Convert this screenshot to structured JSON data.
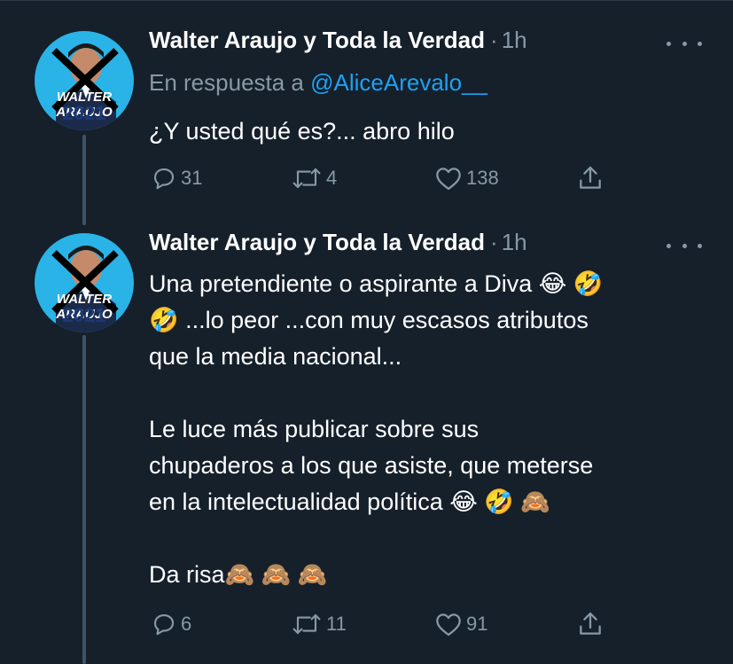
{
  "tweets": [
    {
      "author": "Walter Araujo y Toda la Verdad",
      "dot": "·",
      "time": "1h",
      "reply_prefix": "En respuesta a ",
      "reply_handle": "@AliceArevalo__",
      "text": "¿Y usted qué es?... abro hilo",
      "replies": "31",
      "retweets": "4",
      "likes": "138"
    },
    {
      "author": "Walter Araujo y Toda la Verdad",
      "dot": "·",
      "time": "1h",
      "text": "Una pretendiente o aspirante a Diva 😂 🤣\n🤣 ...lo peor ...con muy escasos atributos\nque la media nacional...\n\nLe luce más publicar sobre sus\nchupaderos a los que asiste, que meterse\nen la intelectualidad política 😂 🤣 🙈\n\nDa risa🙈 🙈 🙈",
      "replies": "6",
      "retweets": "11",
      "likes": "91"
    }
  ],
  "avatar": {
    "line1": "WALTER ARAUJO",
    "line2": "2021"
  },
  "icons": [
    "reply-icon",
    "retweet-icon",
    "like-icon",
    "share-icon",
    "more-icon"
  ],
  "colors": {
    "background": "#15202b",
    "secondary": "#8899a6",
    "link": "#1da1f2"
  }
}
